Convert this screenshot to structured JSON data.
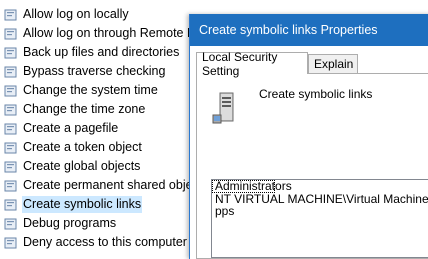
{
  "policies": [
    {
      "label": "Allow log on locally"
    },
    {
      "label": "Allow log on through Remote D"
    },
    {
      "label": "Back up files and directories"
    },
    {
      "label": "Bypass traverse checking"
    },
    {
      "label": "Change the system time"
    },
    {
      "label": "Change the time zone"
    },
    {
      "label": "Create a pagefile"
    },
    {
      "label": "Create a token object"
    },
    {
      "label": "Create global objects"
    },
    {
      "label": "Create permanent shared objec"
    },
    {
      "label": "Create symbolic links",
      "selected": true
    },
    {
      "label": "Debug programs"
    },
    {
      "label": "Deny access to this computer fr"
    }
  ],
  "dialog": {
    "title": "Create symbolic links Properties",
    "tabs": [
      {
        "label": "Local Security Setting",
        "active": true
      },
      {
        "label": "Explain",
        "active": false
      }
    ],
    "policy_name": "Create symbolic links",
    "members": [
      "Administrators",
      "NT VIRTUAL MACHINE\\Virtual Machines",
      "pps"
    ]
  },
  "colors": {
    "titlebar": "#1e6fbf",
    "selection": "#cce8ff"
  },
  "icons": {
    "policy": "policy-setting-icon",
    "server": "server-icon"
  }
}
